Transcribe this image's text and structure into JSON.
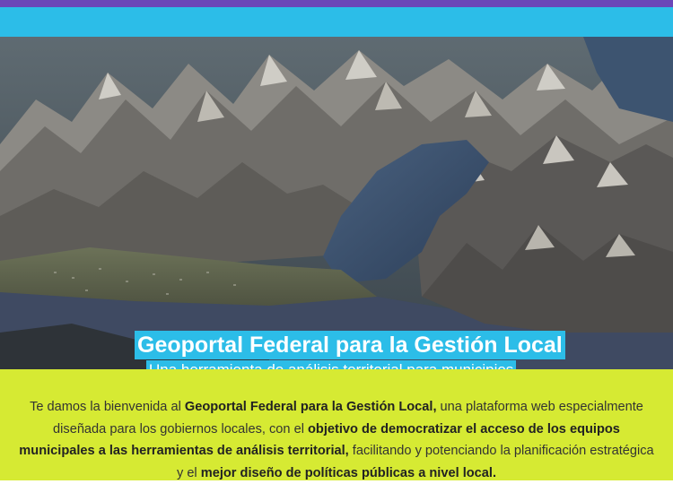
{
  "hero": {
    "title": "Geoportal Federal para la Gestión Local",
    "subtitle": "Una herramienta de análisis territorial para municipios",
    "slides": [
      {
        "label": "slide-1",
        "active": true
      },
      {
        "label": "slide-2",
        "active": false
      },
      {
        "label": "slide-3",
        "active": false
      },
      {
        "label": "slide-4",
        "active": false
      }
    ]
  },
  "intro": {
    "p1": "Te damos la bienvenida al ",
    "b1": "Geoportal Federal para la Gestión Local,",
    "p2": " una plataforma web especialmente diseñada para los gobiernos locales, con el ",
    "b2": "objetivo de democratizar el acceso de los equipos municipales a las herramientas de análisis territorial,",
    "p3": " facilitando y potenciando la planificación estratégica y el ",
    "b3": "mejor diseño de políticas públicas a nivel local."
  },
  "colors": {
    "top_bar": "#6b46b8",
    "accent_cyan": "#2cbde8",
    "intro_bg": "#d6ea33"
  }
}
